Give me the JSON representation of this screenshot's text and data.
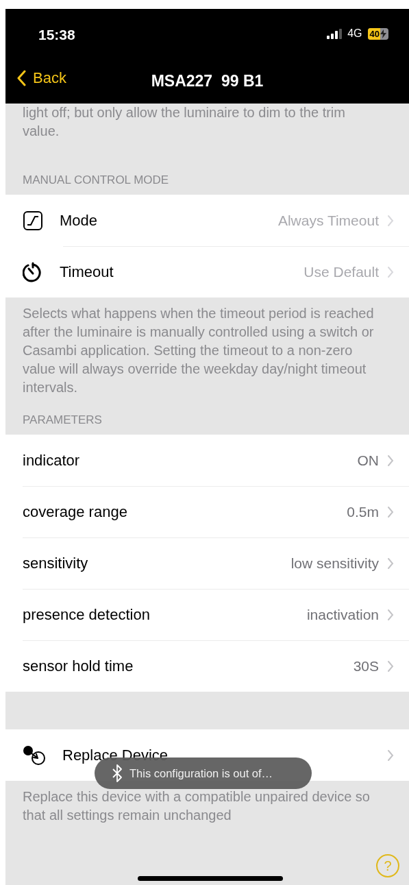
{
  "status_bar": {
    "time": "15:38",
    "network": "4G",
    "battery": "40"
  },
  "nav": {
    "back": "Back",
    "title": "MSA227  99 B1"
  },
  "sections": [
    {
      "note_above": "light off; but only allow the luminaire to dim to the trim value.",
      "header": "MANUAL CONTROL MODE",
      "rows": [
        {
          "kind": "mode",
          "label": "Mode",
          "value": "Always Timeout",
          "disabled": true
        },
        {
          "kind": "timer",
          "label": "Timeout",
          "value": "Use Default",
          "disabled": true
        }
      ],
      "footer": "Selects what happens when the timeout period is reached after the luminaire is manually controlled using a switch or Casambi application. Setting the timeout to a non-zero value will always override the weekday day/night timeout intervals."
    },
    {
      "header": "PARAMETERS",
      "rows": [
        {
          "kind": "plain",
          "label": "indicator",
          "value": "ON",
          "disabled": false
        },
        {
          "kind": "plain",
          "label": "coverage range",
          "value": "0.5m",
          "disabled": false
        },
        {
          "kind": "plain",
          "label": "sensitivity",
          "value": "low sensitivity",
          "disabled": false
        },
        {
          "kind": "plain",
          "label": "presence detection",
          "value": "inactivation",
          "disabled": false
        },
        {
          "kind": "plain",
          "label": "sensor hold time",
          "value": "30S",
          "disabled": false
        }
      ]
    },
    {
      "rows": [
        {
          "kind": "swap",
          "label": "Replace Device"
        }
      ],
      "footer": "Replace this device with a compatible unpaired device so that all settings remain unchanged"
    }
  ],
  "toast": {
    "text": "This configuration is out of…"
  },
  "help": {
    "label": "?"
  }
}
